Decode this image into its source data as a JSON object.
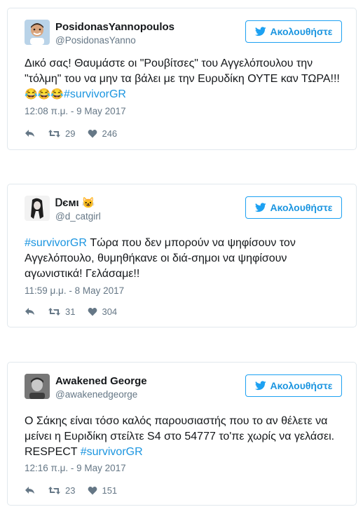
{
  "follow_label": "Ακολουθήστε",
  "tweets": [
    {
      "name": "PosidonasYannopoulos",
      "handle": "@PosidonasYanno",
      "text_before": "Δικό σας! Θαυμάστε οι \"Ρουβίτσες\" του Αγγελόπουλου την \"τόλμη\" του να μην τα βάλει με την Ευρυδίκη ΟΥΤΕ καν ΤΩΡΑ!!! ",
      "emojis": "😂😂😂",
      "hashtag_end": "#survivorGR",
      "timestamp": "12:08 π.μ. - 9 May 2017",
      "retweets": "29",
      "likes": "246"
    },
    {
      "name": "Ꭰємι",
      "name_emoji": "😺",
      "handle": "@d_catgirl",
      "hashtag_start": "#survivorGR",
      "text_after": " Τώρα που δεν μπορούν να ψηφίσουν τον Αγγελόπουλο, θυμηθήκανε οι διά-σημοι να ψηφίσουν αγωνιστικά! Γελάσαμε!!",
      "timestamp": "11:59 μ.μ. - 8 May 2017",
      "retweets": "31",
      "likes": "304"
    },
    {
      "name": "Awakened George",
      "handle": "@awakenedgeorge",
      "text_before": "Ο Σάκης είναι τόσο καλός παρουσιαστής που το αν θέλετε να μείνει η Ευριδίκη στείλτε S4 στο 54777 το'πε χωρίς να γελάσει. RESPECT ",
      "hashtag_end": "#survivorGR",
      "timestamp": "12:16 π.μ. - 9 May 2017",
      "retweets": "23",
      "likes": "151"
    }
  ],
  "colors": {
    "link": "#1b95e0",
    "border": "#e1e8ed",
    "muted": "#657786",
    "text": "#14171a"
  },
  "icons": [
    "twitter-bird-icon",
    "reply-icon",
    "retweet-icon",
    "heart-icon"
  ]
}
